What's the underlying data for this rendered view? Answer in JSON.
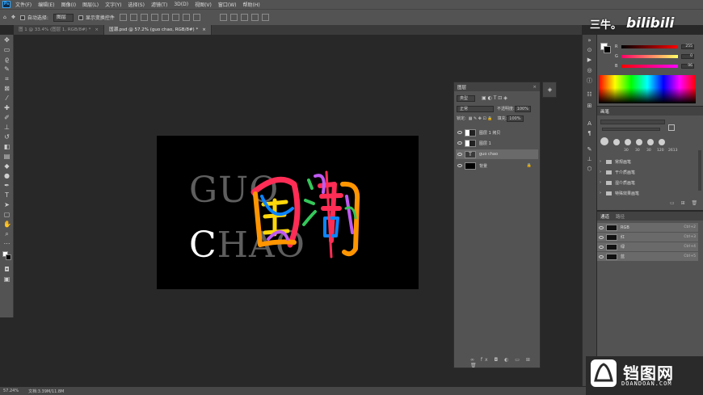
{
  "menubar": {
    "app_icon": "Ps",
    "items": [
      "文件(F)",
      "编辑(E)",
      "图像(I)",
      "图层(L)",
      "文字(Y)",
      "选择(S)",
      "滤镜(T)",
      "3D(D)",
      "视图(V)",
      "窗口(W)",
      "帮助(H)"
    ]
  },
  "options": {
    "auto_select_label": "自动选择:",
    "auto_select_value": "图层",
    "show_transform_label": "显示变换控件"
  },
  "tabs": [
    {
      "label": "图 1 @ 33.4% (图层 1, RGB/8#) *",
      "close": "×"
    },
    {
      "label": "国潮.psd @ 57.2% (guo chao, RGB/8#) *",
      "close": "×"
    }
  ],
  "artwork": {
    "line1": "GUO",
    "line2": "CHAO",
    "calligraphy": "国潮",
    "colors": [
      "#ff2d55",
      "#ff9500",
      "#ffd60a",
      "#34c759",
      "#0a84ff",
      "#bf5af2"
    ]
  },
  "status": {
    "zoom": "57.24%",
    "doc": "文档:3.39M/11.8M"
  },
  "layers_panel": {
    "title": "图层",
    "close": "×",
    "kind_label": "类型",
    "blend_mode": "正常",
    "opacity_label": "不透明度:",
    "opacity_value": "100%",
    "lock_label": "锁定:",
    "fill_label": "填充:",
    "fill_value": "100%",
    "layers": [
      {
        "name": "图层 1 拷贝"
      },
      {
        "name": "图层 1"
      },
      {
        "name": "guo chao",
        "thumb": "T"
      },
      {
        "name": "背景"
      }
    ]
  },
  "color_panel": {
    "channels": [
      {
        "label": "R",
        "value": "255"
      },
      {
        "label": "G",
        "value": "0"
      },
      {
        "label": "B",
        "value": "96"
      }
    ]
  },
  "brushes_panel": {
    "title": "画笔",
    "sizes": [
      "30",
      "30",
      "30",
      "120",
      "2613"
    ],
    "folders": [
      "常规画笔",
      "干介质画笔",
      "湿介质画笔",
      "特殊效果画笔"
    ]
  },
  "channels_panel": {
    "tab_channels": "通道",
    "tab_paths": "路径",
    "rows": [
      {
        "name": "RGB",
        "key": "Ctrl+2"
      },
      {
        "name": "红",
        "key": "Ctrl+3"
      },
      {
        "name": "绿",
        "key": "Ctrl+4"
      },
      {
        "name": "蓝",
        "key": "Ctrl+5"
      }
    ]
  },
  "watermark": {
    "uploader": "三牛。",
    "bilibili": "bilibili",
    "site_name": "铛图网",
    "site_url": "DOANDOAN.COM"
  }
}
